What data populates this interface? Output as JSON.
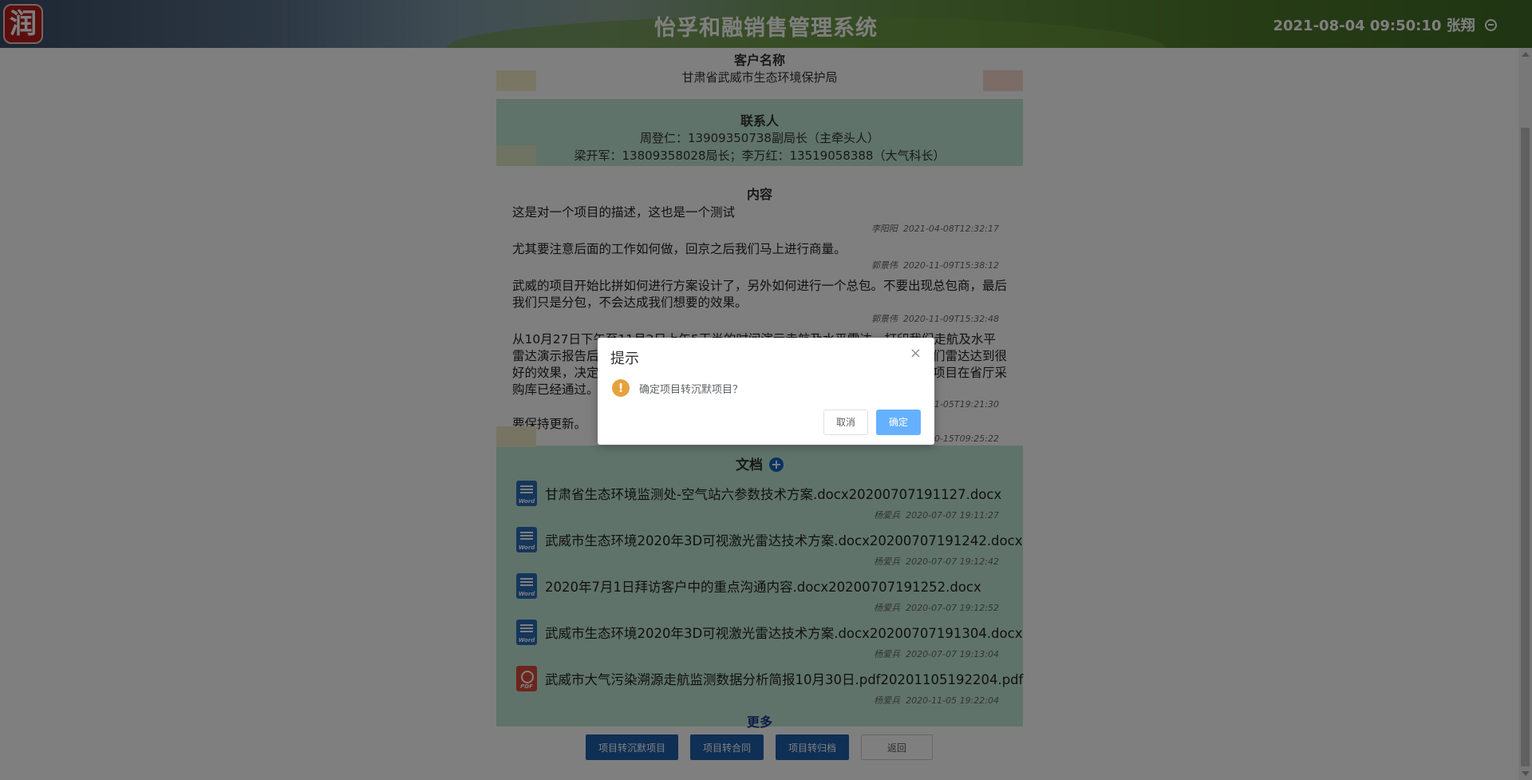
{
  "header": {
    "logo_char": "润",
    "title": "怡孚和融销售管理系统",
    "datetime": "2021-08-04 09:50:10",
    "user": "张翔"
  },
  "customer": {
    "heading": "客户名称",
    "name": "甘肃省武威市生态环境保护局"
  },
  "contact": {
    "heading": "联系人",
    "line1": "周登仁：13909350738副局长（主牵头人）",
    "line2": "梁开军：13809358028局长；李万红：13519058388（大气科长）"
  },
  "content": {
    "heading": "内容",
    "entries": [
      {
        "text": "这是对一个项目的描述，这也是一个测试",
        "author": "李阳阳",
        "time": "2021-04-08T12:32:17"
      },
      {
        "text": "尤其要注意后面的工作如何做，回京之后我们马上进行商量。",
        "author": "郭景伟",
        "time": "2020-11-09T15:38:12"
      },
      {
        "text": "武威的项目开始比拼如何进行方案设计了，另外如何进行一个总包。不要出现总包商，最后我们只是分包，不会达成我们想要的效果。",
        "author": "郭景伟",
        "time": "2020-11-09T15:32:48"
      },
      {
        "text": "从10月27日下午至11月2日上午5天半的时间演示走航及水平雷达，打印我们走航及水平雷达演示报告后，梁局长组织环保局领导开会讨论，认为用科技手段监测使我们雷达达到很好的效果，决定开始做该项目的前期工作。目前该市已经申请了资金，我们的项目在省厅采购库已经通过。",
        "author": "",
        "time": "1-05T19:21:30"
      },
      {
        "text": "要保持更新。",
        "author": "",
        "time": "0-15T09:25:22"
      }
    ]
  },
  "docs": {
    "heading": "文档",
    "files": [
      {
        "name": "甘肃省生态环境监测处-空气站六参数技术方案.docx20200707191127.docx",
        "type": "word",
        "author": "杨爱兵",
        "time": "2020-07-07 19:11:27"
      },
      {
        "name": "武威市生态环境2020年3D可视激光雷达技术方案.docx20200707191242.docx",
        "type": "word",
        "author": "杨爱兵",
        "time": "2020-07-07 19:12:42"
      },
      {
        "name": "2020年7月1日拜访客户中的重点沟通内容.docx20200707191252.docx",
        "type": "word",
        "author": "杨爱兵",
        "time": "2020-07-07 19:12:52"
      },
      {
        "name": "武威市生态环境2020年3D可视激光雷达技术方案.docx20200707191304.docx",
        "type": "word",
        "author": "杨爱兵",
        "time": "2020-07-07 19:13:04"
      },
      {
        "name": "武威市大气污染溯源走航监测数据分析简报10月30日.pdf20201105192204.pdf",
        "type": "pdf",
        "author": "杨爱兵",
        "time": "2020-11-05 19:22:04"
      }
    ],
    "more_label": "更多",
    "word_label": "Word",
    "pdf_label": "PDF"
  },
  "actions": {
    "to_silent": "项目转沉默项目",
    "to_contract": "项目转合同",
    "to_archive": "项目转归档",
    "back": "返回"
  },
  "dialog": {
    "title": "提示",
    "message": "确定项目转沉默项目？",
    "cancel": "取消",
    "confirm": "确定",
    "close_glyph": "×",
    "warn_glyph": "!"
  },
  "colors": {
    "primary_button": "#1e5faa",
    "section_bg": "#bfe6d6",
    "confirm_button": "#66b1ff",
    "warning_icon": "#e6a23c"
  }
}
